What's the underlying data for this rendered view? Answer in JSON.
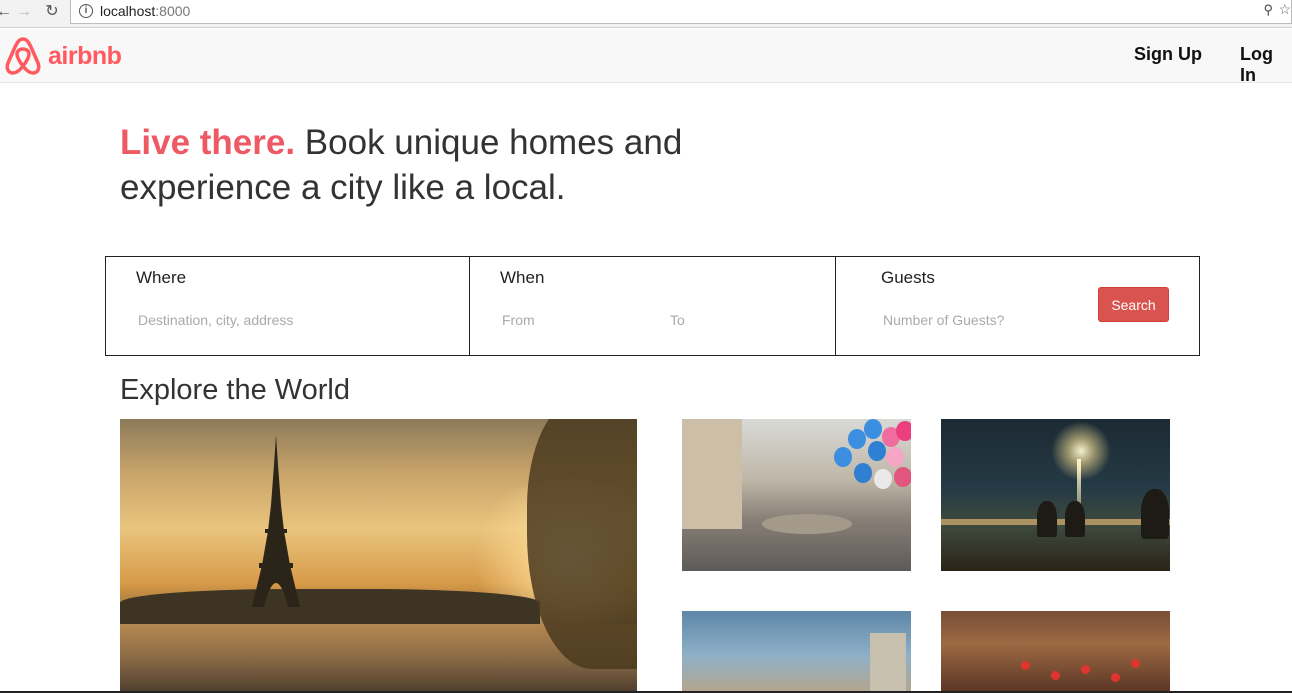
{
  "browser": {
    "url_host": "localhost",
    "url_port": ":8000",
    "back_icon": "arrow-left",
    "forward_icon": "arrow-right",
    "reload_icon": "reload",
    "info_icon": "info-circle",
    "key_icon": "key",
    "star_icon": "star"
  },
  "header": {
    "logo_text": "airbnb",
    "sign_up": "Sign Up",
    "log_in": "Log In"
  },
  "hero": {
    "accent": "Live there.",
    "line1": " Book unique homes and",
    "line2": "experience a city like a local."
  },
  "search": {
    "where_label": "Where",
    "where_placeholder": "Destination, city, address",
    "when_label": "When",
    "from_placeholder": "From",
    "to_placeholder": "To",
    "guests_label": "Guests",
    "guests_placeholder": "Number of Guests?",
    "button_label": "Search"
  },
  "explore": {
    "title": "Explore the World"
  },
  "colors": {
    "brand": "#ff5a5f",
    "accent_text": "#ed5a64",
    "search_button": "#d9534f"
  }
}
